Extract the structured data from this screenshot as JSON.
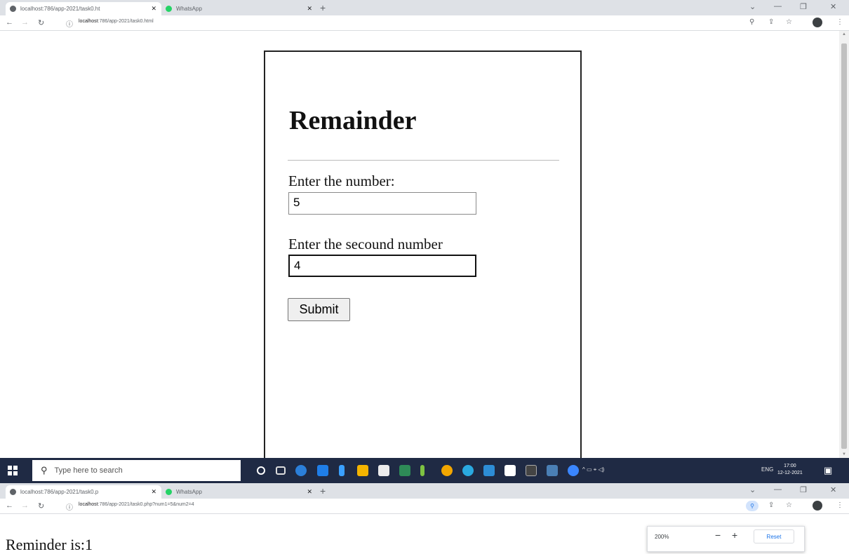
{
  "browser_top": {
    "tabs": [
      {
        "title": "localhost:786/app-2021/task0.ht",
        "favicon_color": "#5f6368",
        "active": true
      },
      {
        "title": "WhatsApp",
        "favicon_color": "#25d366",
        "active": false
      }
    ],
    "url_host": "localhost",
    "url_rest": ":786/app-2021/task0.html"
  },
  "form": {
    "title": "Remainder",
    "label1": "Enter the number:",
    "value1": "5",
    "label2": "Enter the secound number",
    "value2": "4",
    "submit_label": "Submit"
  },
  "taskbar": {
    "search_placeholder": "Type here to search",
    "tray_lang": "ENG",
    "time": "17:00",
    "date": "12-12-2021"
  },
  "browser_bottom": {
    "tabs": [
      {
        "title": "localhost:786/app-2021/task0.p",
        "favicon_color": "#5f6368",
        "active": true
      },
      {
        "title": "WhatsApp",
        "favicon_color": "#25d366",
        "active": false
      }
    ],
    "url_host": "localhost",
    "url_rest": ":786/app-2021/task0.php?num1=5&num2=4"
  },
  "result": {
    "text": "Reminder is:1"
  },
  "zoom_popup": {
    "level": "200%",
    "reset_label": "Reset"
  }
}
